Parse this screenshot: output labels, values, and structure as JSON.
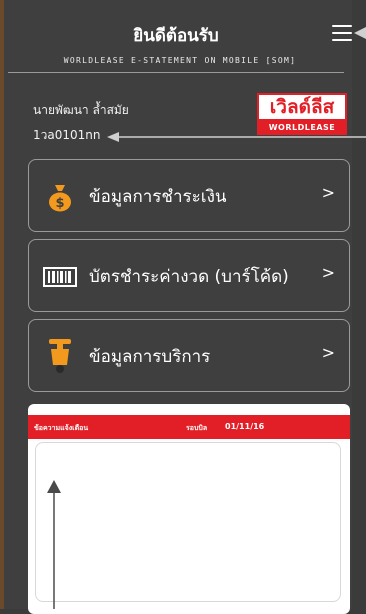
{
  "header": {
    "title": "ยินดีต้อนรับ",
    "subtitle": "WORLDLEASE E-STATEMENT ON MOBILE [SOM]"
  },
  "user": {
    "name": "นายพัฒนา ล้ำสมัย",
    "id": "1วa0101nn"
  },
  "logo": {
    "thai_text": "เวิลด์ลีส",
    "english_text": "WORLDLEASE"
  },
  "menu": [
    {
      "label": "ข้อมูลการชำระเงิน",
      "icon": "money-bag-icon",
      "chevron": ">"
    },
    {
      "label": "บัตรชำระค่างวด (บาร์โค้ด)",
      "icon": "barcode-icon",
      "chevron": ">"
    },
    {
      "label": "ข้อมูลการบริการ",
      "icon": "scooter-icon",
      "chevron": ">"
    }
  ],
  "notice": {
    "label": "ข้อความแจ้งเตือน",
    "cycle_label": "รอบบิล",
    "date": "01/11/16"
  },
  "colors": {
    "background": "#3f3f3f",
    "accent": "#e21f26",
    "icon_orange": "#f39a1e"
  }
}
